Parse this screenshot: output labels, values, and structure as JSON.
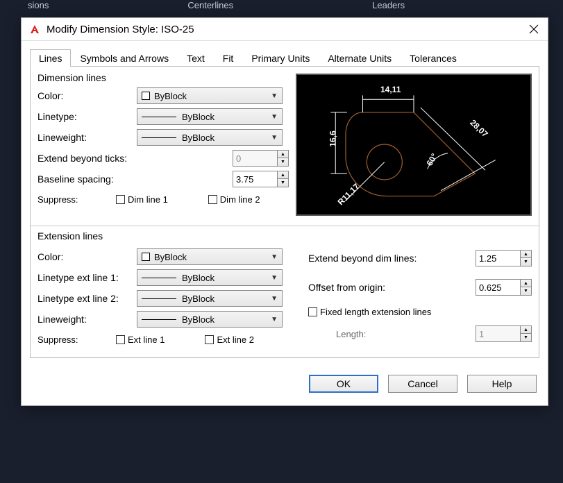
{
  "ribbon": {
    "items": [
      "sions",
      "Centerlines",
      "Leaders"
    ]
  },
  "dialog": {
    "title": "Modify Dimension Style: ISO-25",
    "tabs": [
      "Lines",
      "Symbols and Arrows",
      "Text",
      "Fit",
      "Primary Units",
      "Alternate Units",
      "Tolerances"
    ],
    "active_tab": "Lines"
  },
  "dimension_lines": {
    "group_title": "Dimension lines",
    "color_label": "Color:",
    "color_value": "ByBlock",
    "linetype_label": "Linetype:",
    "linetype_value": "ByBlock",
    "lineweight_label": "Lineweight:",
    "lineweight_value": "ByBlock",
    "extend_ticks_label": "Extend beyond ticks:",
    "extend_ticks_value": "0",
    "baseline_label": "Baseline spacing:",
    "baseline_value": "3.75",
    "suppress_label": "Suppress:",
    "suppress1": "Dim line 1",
    "suppress2": "Dim line 2"
  },
  "extension_lines": {
    "group_title": "Extension lines",
    "color_label": "Color:",
    "color_value": "ByBlock",
    "lt1_label": "Linetype ext line 1:",
    "lt1_value": "ByBlock",
    "lt2_label": "Linetype ext line 2:",
    "lt2_value": "ByBlock",
    "lineweight_label": "Lineweight:",
    "lineweight_value": "ByBlock",
    "suppress_label": "Suppress:",
    "suppress1": "Ext line 1",
    "suppress2": "Ext line 2",
    "extend_dim_label": "Extend beyond dim lines:",
    "extend_dim_value": "1.25",
    "offset_label": "Offset from origin:",
    "offset_value": "0.625",
    "fixed_label": "Fixed length extension lines",
    "length_label": "Length:",
    "length_value": "1"
  },
  "preview": {
    "dim_top": "14,11",
    "dim_left": "16,6",
    "dim_right": "28,07",
    "dim_angle": "60°",
    "dim_radius": "R11,17"
  },
  "buttons": {
    "ok": "OK",
    "cancel": "Cancel",
    "help": "Help"
  }
}
